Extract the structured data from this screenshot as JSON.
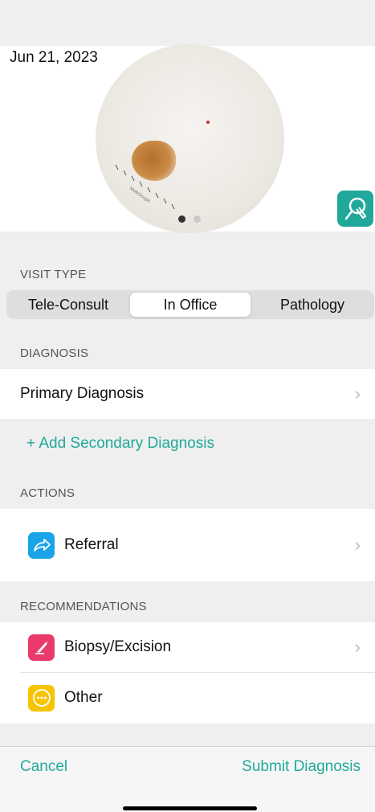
{
  "header": {
    "date": "Jun 21, 2023"
  },
  "image": {
    "pager_count": 2,
    "active_page": 0
  },
  "visit_type": {
    "header": "VISIT TYPE",
    "options": [
      "Tele-Consult",
      "In Office",
      "Pathology"
    ],
    "selected": "In Office"
  },
  "diagnosis": {
    "header": "DIAGNOSIS",
    "primary_label": "Primary Diagnosis",
    "add_secondary_label": "+ Add Secondary Diagnosis"
  },
  "actions": {
    "header": "ACTIONS",
    "items": [
      {
        "label": "Referral",
        "icon": "share-arrow-icon",
        "color": "#1aa3e8"
      }
    ]
  },
  "recommendations": {
    "header": "RECOMMENDATIONS",
    "items": [
      {
        "label": "Biopsy/Excision",
        "icon": "scalpel-icon",
        "color": "#ea3a6c"
      },
      {
        "label": "Other",
        "icon": "ellipsis-icon",
        "color": "#f6c400"
      }
    ]
  },
  "footer": {
    "cancel_label": "Cancel",
    "submit_label": "Submit Diagnosis"
  },
  "colors": {
    "accent": "#20a99a",
    "background": "#efefef"
  }
}
